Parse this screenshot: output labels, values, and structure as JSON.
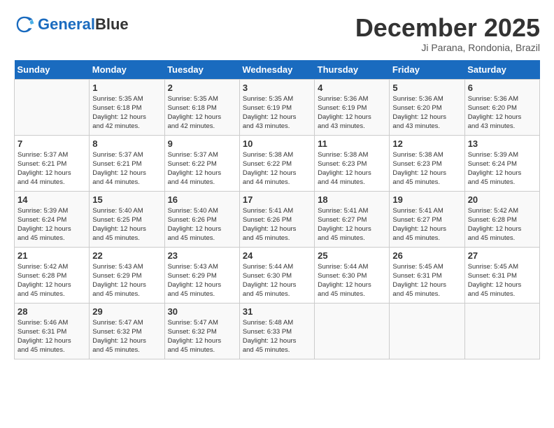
{
  "header": {
    "logo_line1": "General",
    "logo_line2": "Blue",
    "month": "December 2025",
    "location": "Ji Parana, Rondonia, Brazil"
  },
  "days_of_week": [
    "Sunday",
    "Monday",
    "Tuesday",
    "Wednesday",
    "Thursday",
    "Friday",
    "Saturday"
  ],
  "weeks": [
    [
      {
        "day": "",
        "info": ""
      },
      {
        "day": "1",
        "info": "Sunrise: 5:35 AM\nSunset: 6:18 PM\nDaylight: 12 hours\nand 42 minutes."
      },
      {
        "day": "2",
        "info": "Sunrise: 5:35 AM\nSunset: 6:18 PM\nDaylight: 12 hours\nand 42 minutes."
      },
      {
        "day": "3",
        "info": "Sunrise: 5:35 AM\nSunset: 6:19 PM\nDaylight: 12 hours\nand 43 minutes."
      },
      {
        "day": "4",
        "info": "Sunrise: 5:36 AM\nSunset: 6:19 PM\nDaylight: 12 hours\nand 43 minutes."
      },
      {
        "day": "5",
        "info": "Sunrise: 5:36 AM\nSunset: 6:20 PM\nDaylight: 12 hours\nand 43 minutes."
      },
      {
        "day": "6",
        "info": "Sunrise: 5:36 AM\nSunset: 6:20 PM\nDaylight: 12 hours\nand 43 minutes."
      }
    ],
    [
      {
        "day": "7",
        "info": "Sunrise: 5:37 AM\nSunset: 6:21 PM\nDaylight: 12 hours\nand 44 minutes."
      },
      {
        "day": "8",
        "info": "Sunrise: 5:37 AM\nSunset: 6:21 PM\nDaylight: 12 hours\nand 44 minutes."
      },
      {
        "day": "9",
        "info": "Sunrise: 5:37 AM\nSunset: 6:22 PM\nDaylight: 12 hours\nand 44 minutes."
      },
      {
        "day": "10",
        "info": "Sunrise: 5:38 AM\nSunset: 6:22 PM\nDaylight: 12 hours\nand 44 minutes."
      },
      {
        "day": "11",
        "info": "Sunrise: 5:38 AM\nSunset: 6:23 PM\nDaylight: 12 hours\nand 44 minutes."
      },
      {
        "day": "12",
        "info": "Sunrise: 5:38 AM\nSunset: 6:23 PM\nDaylight: 12 hours\nand 45 minutes."
      },
      {
        "day": "13",
        "info": "Sunrise: 5:39 AM\nSunset: 6:24 PM\nDaylight: 12 hours\nand 45 minutes."
      }
    ],
    [
      {
        "day": "14",
        "info": "Sunrise: 5:39 AM\nSunset: 6:24 PM\nDaylight: 12 hours\nand 45 minutes."
      },
      {
        "day": "15",
        "info": "Sunrise: 5:40 AM\nSunset: 6:25 PM\nDaylight: 12 hours\nand 45 minutes."
      },
      {
        "day": "16",
        "info": "Sunrise: 5:40 AM\nSunset: 6:26 PM\nDaylight: 12 hours\nand 45 minutes."
      },
      {
        "day": "17",
        "info": "Sunrise: 5:41 AM\nSunset: 6:26 PM\nDaylight: 12 hours\nand 45 minutes."
      },
      {
        "day": "18",
        "info": "Sunrise: 5:41 AM\nSunset: 6:27 PM\nDaylight: 12 hours\nand 45 minutes."
      },
      {
        "day": "19",
        "info": "Sunrise: 5:41 AM\nSunset: 6:27 PM\nDaylight: 12 hours\nand 45 minutes."
      },
      {
        "day": "20",
        "info": "Sunrise: 5:42 AM\nSunset: 6:28 PM\nDaylight: 12 hours\nand 45 minutes."
      }
    ],
    [
      {
        "day": "21",
        "info": "Sunrise: 5:42 AM\nSunset: 6:28 PM\nDaylight: 12 hours\nand 45 minutes."
      },
      {
        "day": "22",
        "info": "Sunrise: 5:43 AM\nSunset: 6:29 PM\nDaylight: 12 hours\nand 45 minutes."
      },
      {
        "day": "23",
        "info": "Sunrise: 5:43 AM\nSunset: 6:29 PM\nDaylight: 12 hours\nand 45 minutes."
      },
      {
        "day": "24",
        "info": "Sunrise: 5:44 AM\nSunset: 6:30 PM\nDaylight: 12 hours\nand 45 minutes."
      },
      {
        "day": "25",
        "info": "Sunrise: 5:44 AM\nSunset: 6:30 PM\nDaylight: 12 hours\nand 45 minutes."
      },
      {
        "day": "26",
        "info": "Sunrise: 5:45 AM\nSunset: 6:31 PM\nDaylight: 12 hours\nand 45 minutes."
      },
      {
        "day": "27",
        "info": "Sunrise: 5:45 AM\nSunset: 6:31 PM\nDaylight: 12 hours\nand 45 minutes."
      }
    ],
    [
      {
        "day": "28",
        "info": "Sunrise: 5:46 AM\nSunset: 6:31 PM\nDaylight: 12 hours\nand 45 minutes."
      },
      {
        "day": "29",
        "info": "Sunrise: 5:47 AM\nSunset: 6:32 PM\nDaylight: 12 hours\nand 45 minutes."
      },
      {
        "day": "30",
        "info": "Sunrise: 5:47 AM\nSunset: 6:32 PM\nDaylight: 12 hours\nand 45 minutes."
      },
      {
        "day": "31",
        "info": "Sunrise: 5:48 AM\nSunset: 6:33 PM\nDaylight: 12 hours\nand 45 minutes."
      },
      {
        "day": "",
        "info": ""
      },
      {
        "day": "",
        "info": ""
      },
      {
        "day": "",
        "info": ""
      }
    ]
  ]
}
